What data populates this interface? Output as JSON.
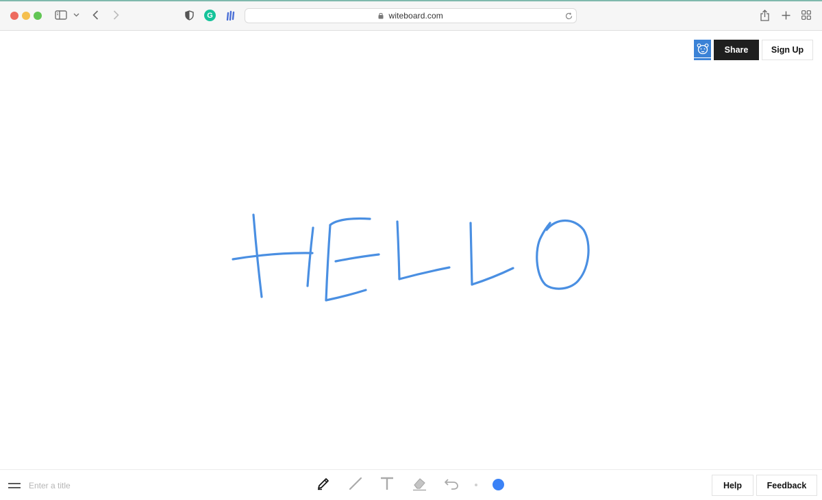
{
  "browser": {
    "url": "witeboard.com",
    "grammarly_letter": "G"
  },
  "header": {
    "share_label": "Share",
    "signup_label": "Sign Up"
  },
  "canvas": {
    "stroke_color": "#4a8fe2"
  },
  "toolbar": {
    "title_placeholder": "Enter a title",
    "title_value": "",
    "selected_tool": "pencil",
    "selected_color": "#3b82f6",
    "tools": [
      "pencil-icon",
      "line-icon",
      "text-icon",
      "eraser-icon",
      "undo-icon"
    ],
    "help_label": "Help",
    "feedback_label": "Feedback"
  }
}
